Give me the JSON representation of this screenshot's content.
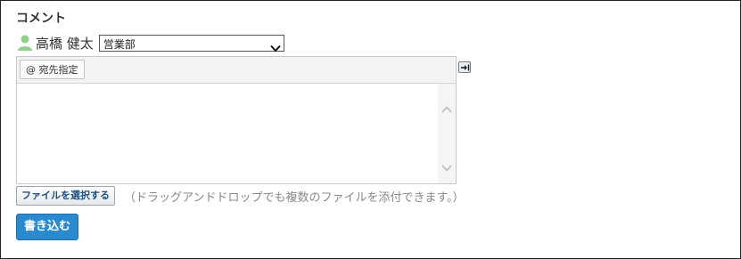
{
  "comment_section": {
    "title": "コメント"
  },
  "author": {
    "name": "高橋 健太",
    "icon": "user-icon",
    "icon_color": "#8fcf8a"
  },
  "department_select": {
    "selected": "営業部"
  },
  "editor": {
    "mention_button_label": "@ 宛先指定",
    "text": ""
  },
  "expand_button": {
    "icon": "expand-arrow-icon"
  },
  "attachments": {
    "select_file_label": "ファイルを選択する",
    "hint": "（ドラッグアンドドロップでも複数のファイルを添付できます。）"
  },
  "submit": {
    "label": "書き込む",
    "color": "#2a89cf"
  }
}
